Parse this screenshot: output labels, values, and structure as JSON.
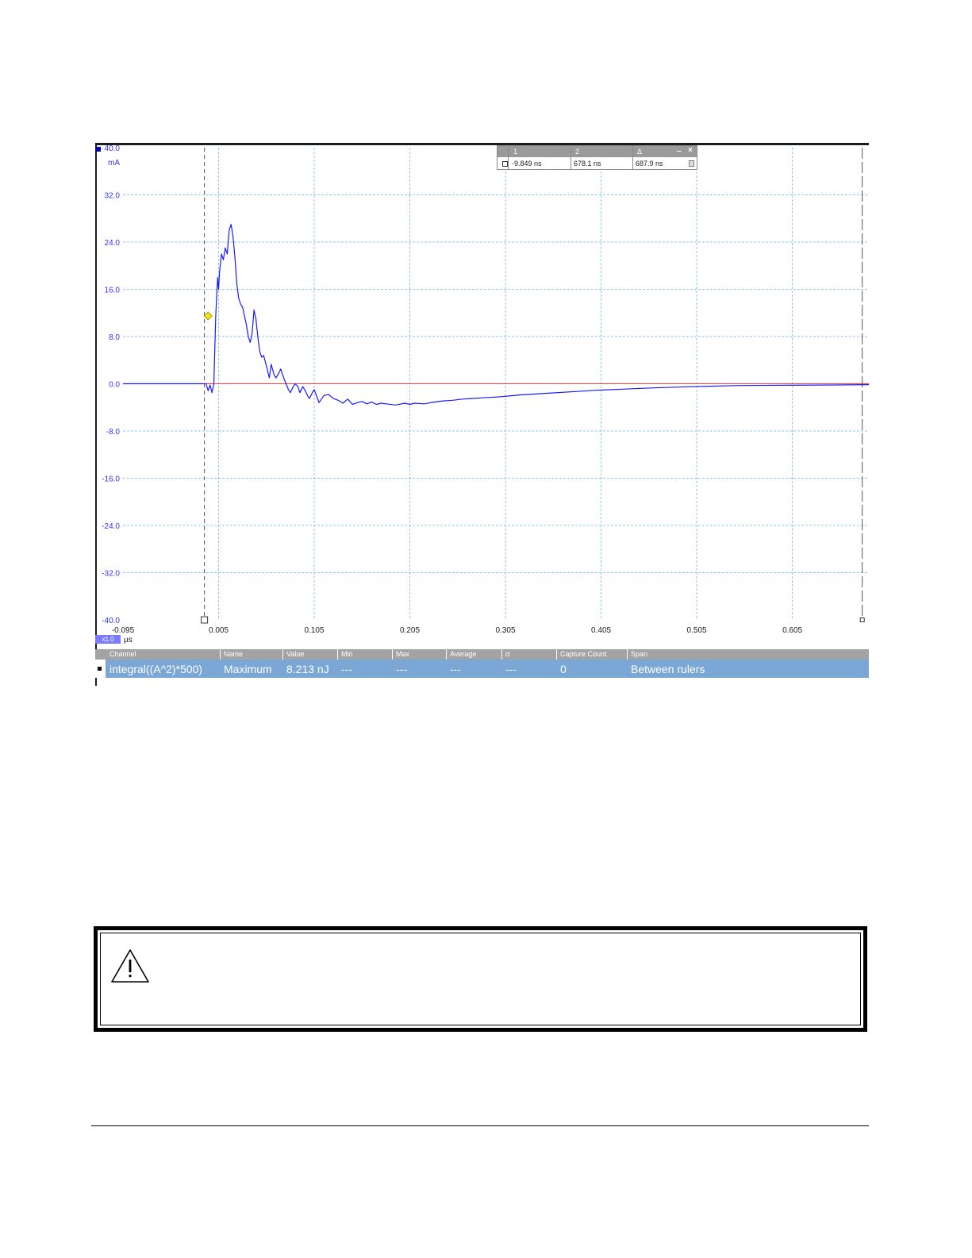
{
  "chart_data": {
    "type": "line",
    "title": "",
    "xlabel": "µs",
    "ylabel": "mA",
    "xlim": [
      -0.095,
      0.685
    ],
    "ylim": [
      -40,
      40
    ],
    "x_ticks": [
      "-0.095",
      "0.005",
      "0.105",
      "0.205",
      "0.305",
      "0.405",
      "0.505",
      "0.605"
    ],
    "y_ticks": [
      "40.0",
      "32.0",
      "24.0",
      "16.0",
      "8.0",
      "0.0",
      "-8.0",
      "-16.0",
      "-24.0",
      "-32.0",
      "-40.0"
    ],
    "grid": true,
    "reference_line_y": 0,
    "rulers_x": [
      -0.00985,
      0.6781
    ],
    "series": [
      {
        "name": "",
        "x": [
          -0.095,
          -0.01,
          -0.008,
          -0.006,
          -0.004,
          -0.002,
          0.0,
          0.002,
          0.003,
          0.004,
          0.005,
          0.006,
          0.008,
          0.01,
          0.012,
          0.014,
          0.016,
          0.018,
          0.02,
          0.022,
          0.024,
          0.026,
          0.028,
          0.03,
          0.032,
          0.034,
          0.036,
          0.038,
          0.04,
          0.042,
          0.044,
          0.046,
          0.048,
          0.05,
          0.052,
          0.055,
          0.058,
          0.06,
          0.063,
          0.065,
          0.068,
          0.07,
          0.073,
          0.075,
          0.078,
          0.08,
          0.083,
          0.085,
          0.088,
          0.09,
          0.093,
          0.095,
          0.098,
          0.1,
          0.103,
          0.105,
          0.11,
          0.115,
          0.12,
          0.125,
          0.13,
          0.135,
          0.14,
          0.145,
          0.15,
          0.155,
          0.16,
          0.165,
          0.17,
          0.175,
          0.18,
          0.19,
          0.2,
          0.205,
          0.21,
          0.22,
          0.23,
          0.24,
          0.25,
          0.26,
          0.27,
          0.28,
          0.3,
          0.32,
          0.35,
          0.38,
          0.4,
          0.43,
          0.46,
          0.5,
          0.55,
          0.6,
          0.65,
          0.685
        ],
        "values": [
          0.0,
          0.0,
          0.0,
          -1.2,
          -0.2,
          -1.5,
          0.0,
          11.5,
          15.0,
          18.0,
          16.0,
          19.0,
          22.0,
          21.0,
          23.0,
          22.0,
          26.0,
          27.0,
          25.0,
          21.5,
          17.0,
          14.5,
          13.5,
          13.0,
          11.5,
          10.0,
          8.0,
          7.0,
          8.5,
          12.5,
          11.0,
          8.0,
          5.5,
          4.5,
          4.8,
          3.0,
          1.0,
          3.3,
          1.5,
          1.0,
          1.8,
          2.5,
          1.0,
          0.2,
          -1.0,
          -1.5,
          -0.5,
          0.0,
          -0.5,
          -1.5,
          -0.5,
          -1.0,
          -2.0,
          -2.5,
          -1.5,
          -1.0,
          -3.2,
          -2.0,
          -1.8,
          -2.5,
          -2.8,
          -3.3,
          -2.6,
          -3.5,
          -3.2,
          -3.0,
          -3.4,
          -3.1,
          -3.5,
          -3.3,
          -3.4,
          -3.6,
          -3.3,
          -3.5,
          -3.3,
          -3.4,
          -3.1,
          -2.9,
          -2.8,
          -2.6,
          -2.5,
          -2.4,
          -2.2,
          -1.9,
          -1.6,
          -1.3,
          -1.1,
          -0.9,
          -0.7,
          -0.5,
          -0.3,
          -0.25,
          -0.2,
          -0.15
        ],
        "color": "#1a1aff"
      }
    ],
    "trigger_marker": {
      "x": -0.006,
      "y": 11.5,
      "color": "#f5e316"
    }
  },
  "ruler_table": {
    "col1_header": "1",
    "col2_header": "2",
    "col3_header": "Δ",
    "col1_value": "-9.849 ns",
    "col2_value": "678.1 ns",
    "col3_value": "687.9 ns",
    "minimize": "‒",
    "close": "×"
  },
  "zoom_badge": "x1.0",
  "x_unit": "µs",
  "y_unit": "mA",
  "measurements": {
    "headers": [
      "Channel",
      "Name",
      "Value",
      "Min",
      "Max",
      "Average",
      "σ",
      "Capture Count",
      "Span"
    ],
    "row": [
      "integral((A^2)*500)",
      "Maximum",
      "8.213 nJ",
      "---",
      "---",
      "---",
      "---",
      "0",
      "Between rulers"
    ]
  },
  "warning": {
    "icon": "warning-triangle-icon",
    "text": ""
  },
  "colors": {
    "trace": "#1a1aff",
    "axis_text": "#3333ff",
    "grid": "#8fc7e8",
    "zero_line": "#ff3b3b",
    "meas_row": "#7aa7d6",
    "meas_header": "#a3a3a3"
  }
}
